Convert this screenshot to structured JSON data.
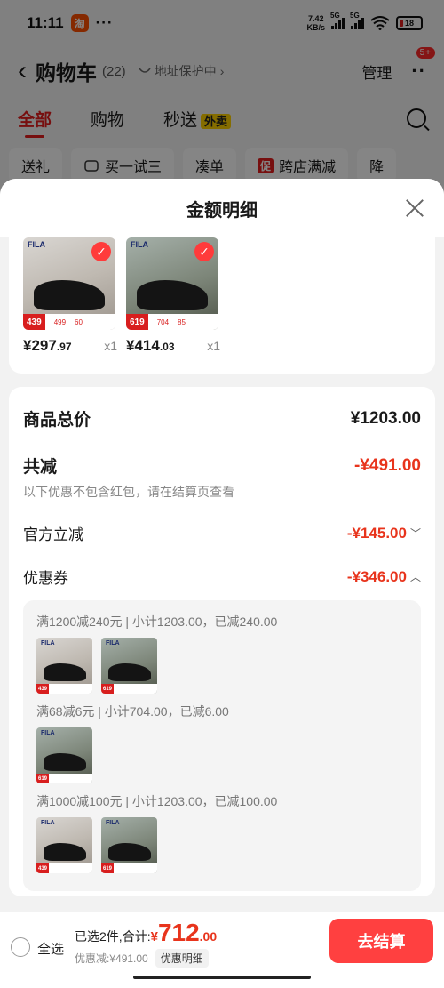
{
  "status": {
    "time": "11:11",
    "app_badge": "淘",
    "dots": "···",
    "speed_value": "7.42",
    "speed_unit": "KB/s",
    "net1": "5G",
    "net2": "5G",
    "battery": "18"
  },
  "nav": {
    "back": "‹",
    "title": "购物车",
    "count": "(22)",
    "address": "地址保护中",
    "address_chevron": "›",
    "manage": "管理",
    "more": "··",
    "more_badge": "5+"
  },
  "tabs": [
    {
      "label": "全部"
    },
    {
      "label": "购物"
    },
    {
      "label": "秒送"
    }
  ],
  "waimai": "外卖",
  "chips": [
    {
      "label": "送礼"
    },
    {
      "label": "买一试三"
    },
    {
      "label": "凑单"
    },
    {
      "label": "跨店满减",
      "badge": "促"
    },
    {
      "label": "降"
    }
  ],
  "sheet": {
    "title": "金额明细"
  },
  "products": [
    {
      "brand": "FILA",
      "strip_price": "439",
      "strip_a": "499",
      "strip_b": "60",
      "price_int": "¥297",
      "price_dec": ".97",
      "qty": "x1"
    },
    {
      "brand": "FILA",
      "strip_price": "619",
      "strip_a": "704",
      "strip_b": "85",
      "price_int": "¥414",
      "price_dec": ".03",
      "qty": "x1"
    }
  ],
  "detail": {
    "total_label": "商品总价",
    "total_value": "¥1203.00",
    "reduce_label": "共减",
    "reduce_value": "-¥491.00",
    "note": "以下优惠不包含红包，请在结算页查看",
    "official_label": "官方立减",
    "official_value": "-¥145.00",
    "official_chevron": "﹀",
    "coupon_label": "优惠券",
    "coupon_value": "-¥346.00",
    "coupon_chevron": "︿"
  },
  "coupons": [
    {
      "title": "满1200减240元 | 小计1203.00，已减240.00",
      "thumbs": [
        {
          "price": "439"
        },
        {
          "price": "619"
        }
      ]
    },
    {
      "title": "满68减6元 | 小计704.00，已减6.00",
      "thumbs": [
        {
          "price": "619"
        }
      ]
    },
    {
      "title": "满1000减100元 | 小计1203.00，已减100.00",
      "thumbs": [
        {
          "price": "439"
        },
        {
          "price": "619"
        }
      ]
    }
  ],
  "bottom": {
    "select_all": "全选",
    "selected_text": "已选2件,合计:",
    "yen": "¥",
    "total_int": "712",
    "total_dec": ".00",
    "discount_text": "优惠减:¥491.00",
    "detail_button": "优惠明细",
    "checkout": "去结算"
  },
  "colors": {
    "accent": "#e8341c",
    "checkout": "#ff4040",
    "tab_active": "#e41d1d"
  }
}
